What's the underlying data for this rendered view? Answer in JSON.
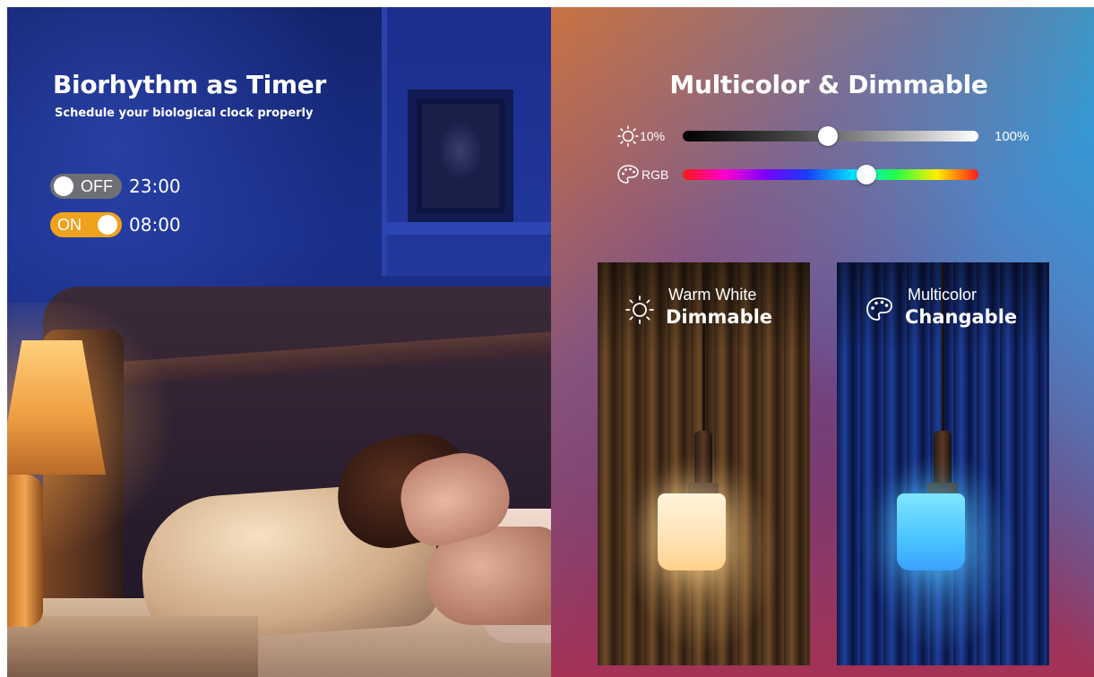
{
  "left_panel": {
    "title": "Biorhythm as Timer",
    "subtitle": "Schedule your biological clock properly",
    "timers": [
      {
        "state": "OFF",
        "time": "23:00",
        "color": "#6f6f76"
      },
      {
        "state": "ON",
        "time": "08:00",
        "color": "#efa21d"
      }
    ]
  },
  "right_panel": {
    "title": "Multicolor & Dimmable",
    "brightness_slider": {
      "icon": "sun-icon",
      "min_label": "10%",
      "max_label": "100%",
      "level_percent": 49
    },
    "rgb_slider": {
      "icon": "palette-icon",
      "label": "RGB",
      "level_percent": 62
    },
    "cards": [
      {
        "icon": "sun-icon",
        "line1": "Warm White",
        "line2": "Dimmable"
      },
      {
        "icon": "palette-icon",
        "line1": "Multicolor",
        "line2": "Changable"
      }
    ]
  }
}
